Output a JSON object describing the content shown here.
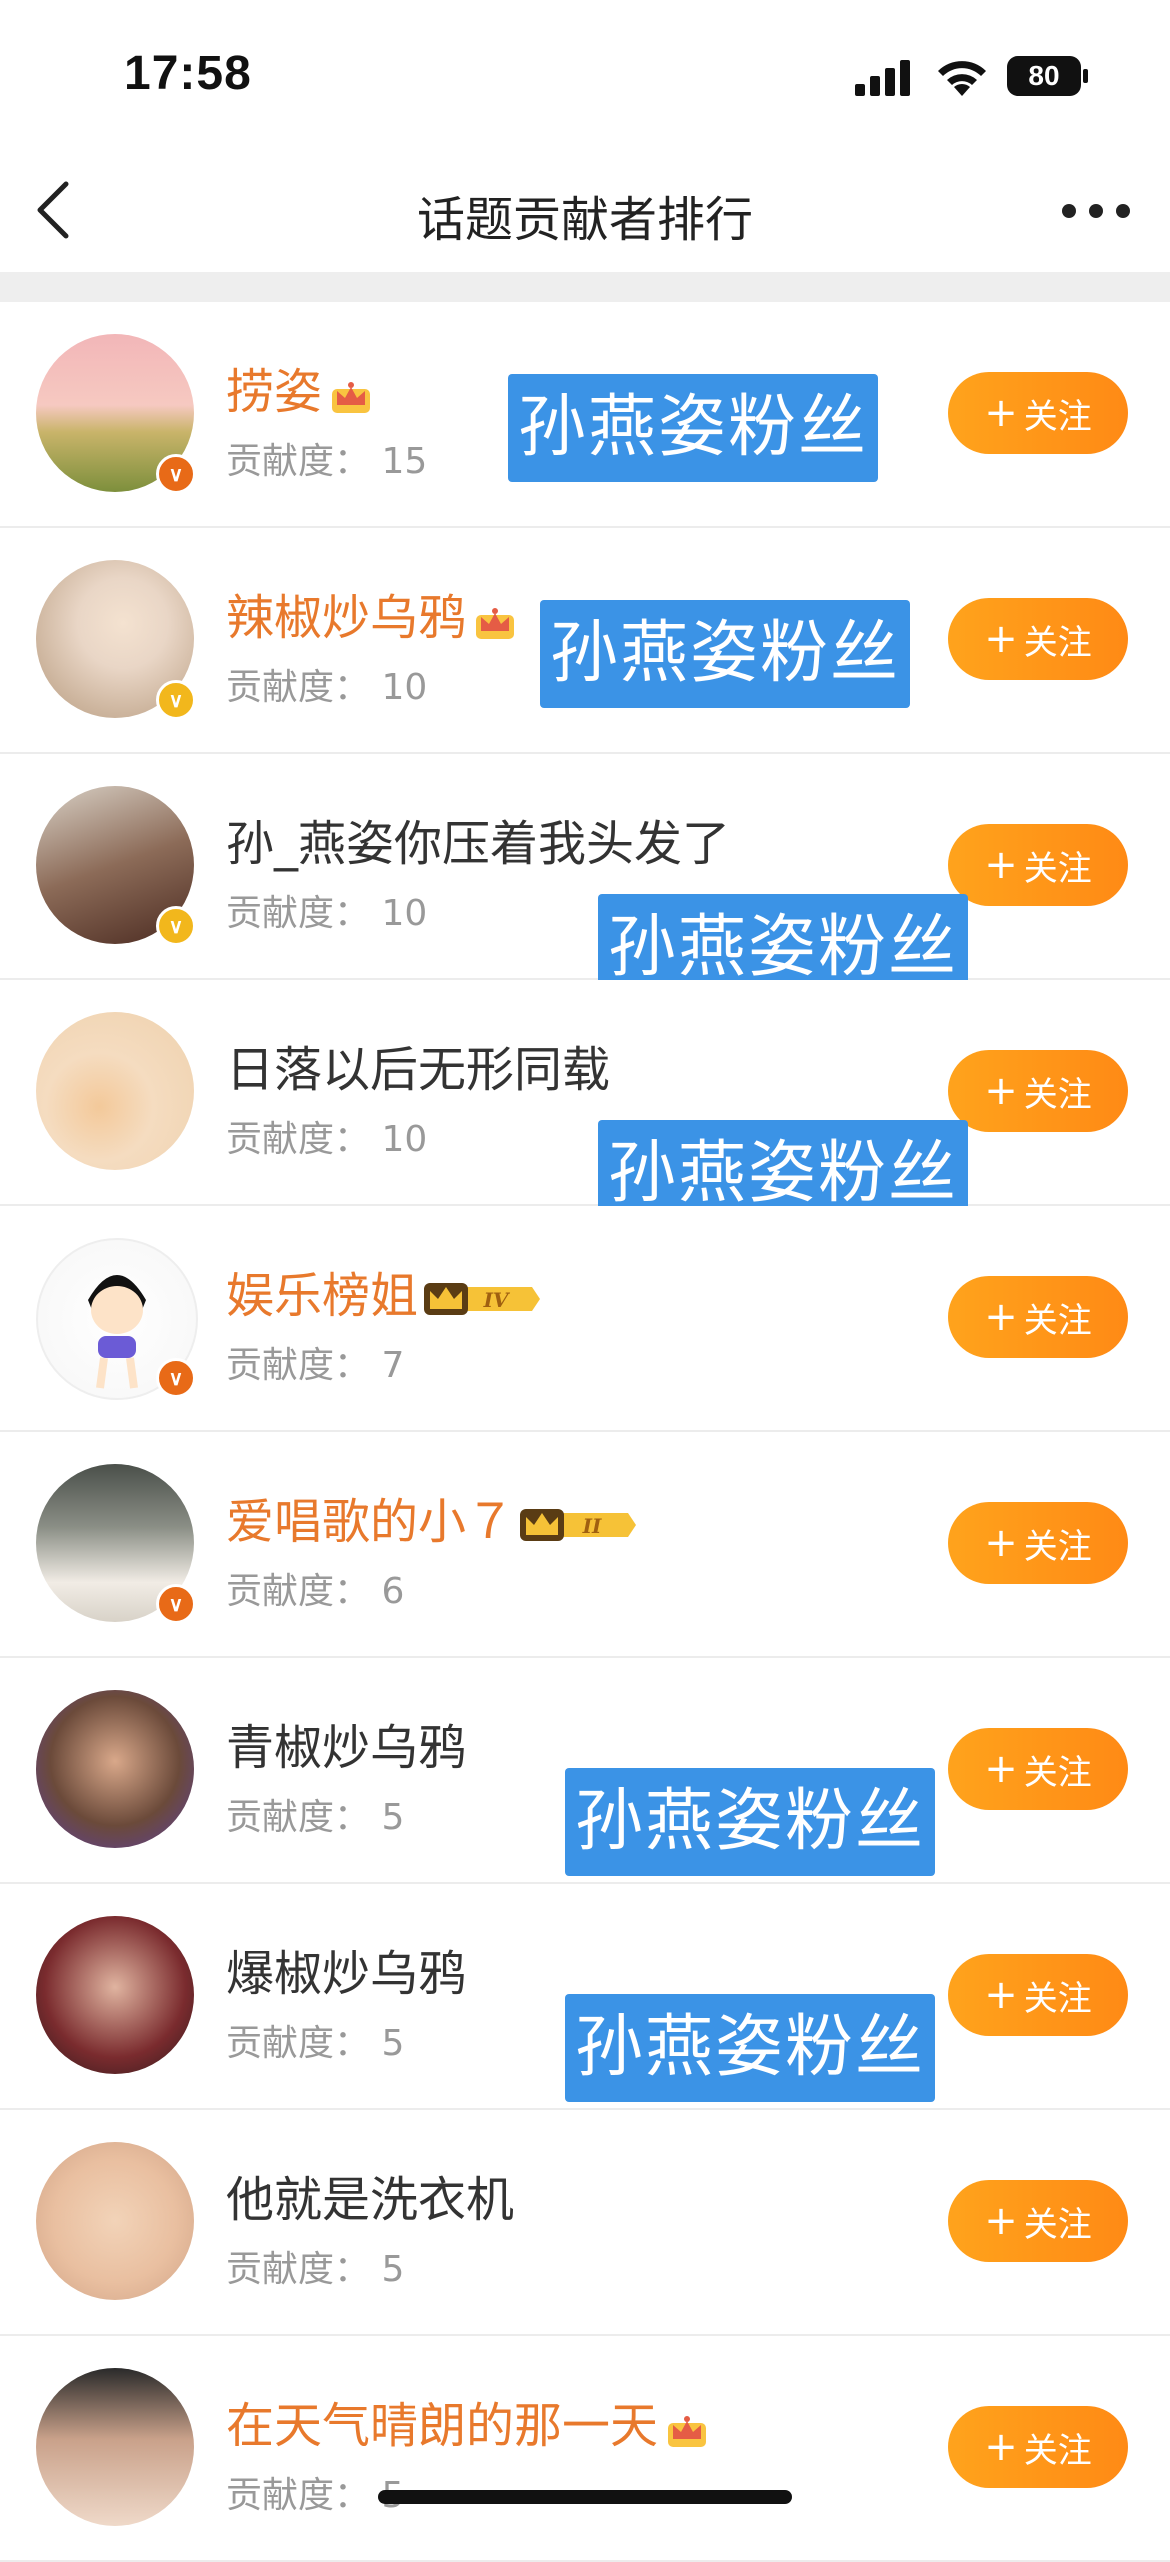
{
  "status": {
    "time": "17:58",
    "battery": "80"
  },
  "nav": {
    "title": "话题贡献者排行"
  },
  "follow_label": "关注",
  "contrib_prefix": "贡献度：",
  "overlay_tag": "孙燕姿粉丝",
  "rows": [
    {
      "name": "捞姿",
      "score": "15",
      "vip": true,
      "badge": "orange",
      "crown": "plain"
    },
    {
      "name": "辣椒炒乌鸦",
      "score": "10",
      "vip": true,
      "badge": "gold",
      "crown": "plain"
    },
    {
      "name": "孙_燕姿你压着我头发了",
      "score": "10",
      "vip": false,
      "badge": "gold",
      "crown": "none"
    },
    {
      "name": "日落以后无形同载",
      "score": "10",
      "vip": false,
      "badge": "none",
      "crown": "none"
    },
    {
      "name": "娱乐榜姐",
      "score": "7",
      "vip": true,
      "badge": "orange",
      "crown": "IV"
    },
    {
      "name": "爱唱歌的小７",
      "score": "6",
      "vip": true,
      "badge": "orange",
      "crown": "II"
    },
    {
      "name": "青椒炒乌鸦",
      "score": "5",
      "vip": false,
      "badge": "none",
      "crown": "none"
    },
    {
      "name": "爆椒炒乌鸦",
      "score": "5",
      "vip": false,
      "badge": "none",
      "crown": "none"
    },
    {
      "name": "他就是洗衣机",
      "score": "5",
      "vip": false,
      "badge": "none",
      "crown": "none"
    },
    {
      "name": "在天气晴朗的那一天",
      "score": "5",
      "vip": true,
      "badge": "none",
      "crown": "plain"
    }
  ]
}
